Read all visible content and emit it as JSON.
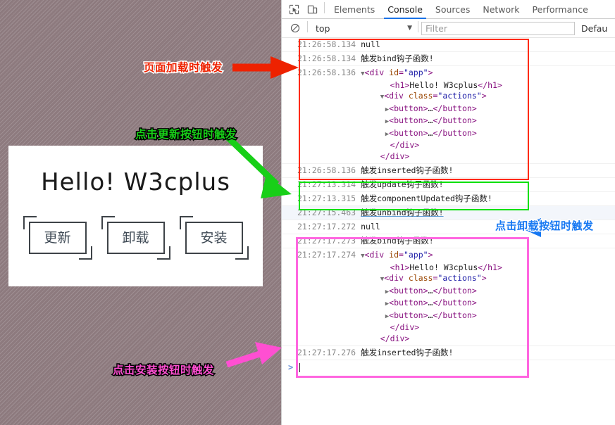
{
  "page": {
    "card": {
      "title": "Hello! W3cplus",
      "buttons": [
        {
          "label": "更新",
          "name": "update-button"
        },
        {
          "label": "卸载",
          "name": "uninstall-button"
        },
        {
          "label": "安装",
          "name": "install-button"
        }
      ]
    },
    "annotations": [
      {
        "id": "load",
        "text": "页面加载时触发",
        "color": "#ee2200"
      },
      {
        "id": "update",
        "text": "点击更新按钮时触发",
        "color": "#18cf18"
      },
      {
        "id": "install",
        "text": "点击安装按钮时触发",
        "color": "#ff4fd2"
      },
      {
        "id": "uninstall",
        "text": "点击卸载按钮时触发",
        "color": "#1577f2"
      }
    ]
  },
  "devtools": {
    "toolbar": {
      "inspect_icon": "inspect-element-icon",
      "device_icon": "device-toolbar-icon",
      "tabs": [
        {
          "label": "Elements",
          "active": false
        },
        {
          "label": "Console",
          "active": true
        },
        {
          "label": "Sources",
          "active": false
        },
        {
          "label": "Network",
          "active": false
        },
        {
          "label": "Performance",
          "active": false
        }
      ]
    },
    "filterbar": {
      "clear_icon": "clear-console-icon",
      "context": "top",
      "context_chevron": "chevron-down-icon",
      "filter_placeholder": "Filter",
      "filter_value": "",
      "levels_label": "Defau"
    },
    "prompt": {
      "caret": ">"
    },
    "log": [
      {
        "type": "text",
        "ts": "21:26:58.134",
        "msg": "null"
      },
      {
        "type": "text",
        "ts": "21:26:58.134",
        "msg": "触发bind钩子函数!"
      },
      {
        "type": "dom",
        "ts": "21:26:58.136"
      },
      {
        "type": "text",
        "ts": "21:26:58.136",
        "msg": "触发inserted钩子函数!"
      },
      {
        "type": "text",
        "ts": "21:27:13.314",
        "msg": "触发update钩子函数!"
      },
      {
        "type": "text",
        "ts": "21:27:13.315",
        "msg": "触发componentUpdated钩子函数!"
      },
      {
        "type": "link",
        "ts": "21:27:15.463",
        "msg": "触发unbind钩子函数!"
      },
      {
        "type": "text",
        "ts": "21:27:17.272",
        "msg": "null"
      },
      {
        "type": "text",
        "ts": "21:27:17.273",
        "msg": "触发bind钩子函数!"
      },
      {
        "type": "dom",
        "ts": "21:27:17.274"
      },
      {
        "type": "text",
        "ts": "21:27:17.276",
        "msg": "触发inserted钩子函数!"
      }
    ],
    "dom_snippet": {
      "root_open": "<div id=\"app\">",
      "h1": "<h1>Hello! W3cplus</h1>",
      "actions_open": "<div class=\"actions\">",
      "button_line": "<button>…</button>",
      "button_count": 3,
      "close_inner": "</div>",
      "close_root": "</div>"
    },
    "highlights": [
      {
        "id": "red-box",
        "color": "#ff2a00"
      },
      {
        "id": "green-box",
        "color": "#00e000"
      },
      {
        "id": "pink-box",
        "color": "#ff66e0"
      }
    ]
  }
}
